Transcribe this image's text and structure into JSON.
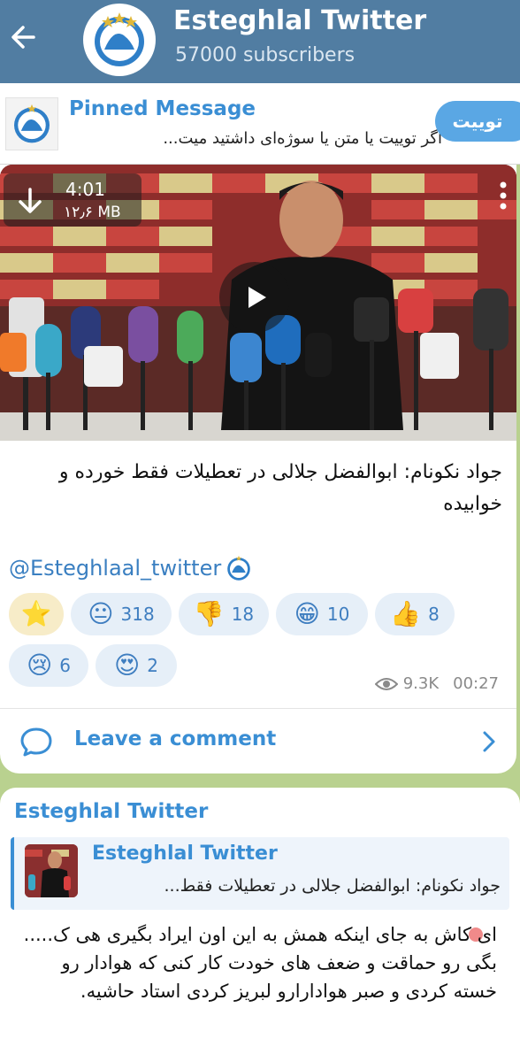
{
  "header": {
    "title": "Esteghlal Twitter",
    "subscribers": "57000 subscribers"
  },
  "pinned": {
    "title": "Pinned Message",
    "text": "اگر توییت یا متن یا سوژه‌ای داشتید میت...",
    "button_label": "توییت"
  },
  "post": {
    "video": {
      "duration": "4:01",
      "size": "۱۲٫۶ MB"
    },
    "caption": "جواد نکونام: ابوالفضل جلالی در تعطیلات فقط خورده و خوابیده",
    "handle": "@Esteghlaal_twitter",
    "reactions": [
      {
        "emoji": "⭐",
        "count": ""
      },
      {
        "emoji": "😐",
        "count": "318"
      },
      {
        "emoji": "👎",
        "count": "18"
      },
      {
        "emoji": "😁",
        "count": "10"
      },
      {
        "emoji": "👍",
        "count": "8"
      },
      {
        "emoji": "😢",
        "count": "6"
      },
      {
        "emoji": "😍",
        "count": "2"
      }
    ],
    "views": "9.3K",
    "time": "00:27",
    "comment_label": "Leave a comment"
  },
  "comment": {
    "author": "Esteghlal Twitter",
    "reply": {
      "author": "Esteghlal Twitter",
      "text": "جواد نکونام: ابوالفضل جلالی در تعطیلات فقط..."
    },
    "text": "ای کاش به جای اینکه همش به این اون ایراد بگیری هی ک..... بگی رو حماقت و ضعف های خودت کار کنی که هوادار رو خسته کردی و صبر هوادارارو لبریز کردی استاد حاشیه."
  },
  "colors": {
    "header_bg": "#517da2",
    "accent": "#3a8ed4",
    "chat_bg": "#b9d18f",
    "reaction_bg": "#e6eff8"
  }
}
